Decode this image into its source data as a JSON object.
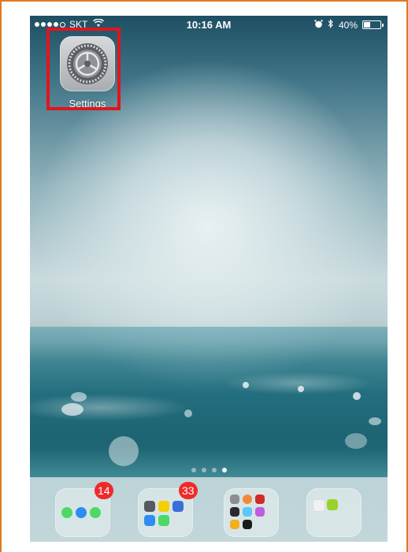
{
  "status_bar": {
    "carrier": "SKT",
    "time": "10:16 AM",
    "battery_percent": "40%",
    "battery_level": 0.4,
    "signal_bars_filled": 4,
    "signal_bars_total": 5
  },
  "home_screen": {
    "apps": [
      {
        "label": "Settings",
        "icon": "settings-gear-icon",
        "highlighted": true,
        "highlight_color": "#e3141b"
      }
    ],
    "page_dots": {
      "count": 4,
      "active_index": 3
    }
  },
  "dock": {
    "folders": [
      {
        "name": "folder-1",
        "badge": "14",
        "icons": [
          "messages-icon",
          "safari-icon",
          "phone-icon"
        ]
      },
      {
        "name": "folder-2",
        "badge": "33",
        "icons": [
          "app-icon",
          "chat-icon",
          "app-n-icon",
          "app-icon",
          "facetime-icon"
        ]
      },
      {
        "name": "folder-3",
        "badge": "",
        "icons": [
          "camera-icon",
          "photos-icon",
          "photo-booth-icon",
          "clips-icon",
          "app-icon",
          "photo-icon",
          "app-icon",
          "app-icon"
        ]
      },
      {
        "name": "folder-4",
        "badge": "",
        "icons": [
          "music-icon",
          "app-icon"
        ]
      }
    ]
  },
  "colors": {
    "frame_border": "#e07a1f",
    "badge": "#ee2a2a"
  }
}
